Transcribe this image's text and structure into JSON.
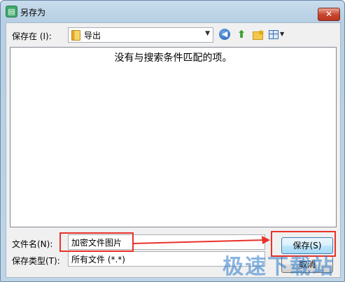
{
  "window": {
    "title": "另存为",
    "close_glyph": "✕"
  },
  "toolbar": {
    "save_in_label": "保存在 (I):",
    "location": "导出",
    "back_icon": "back-arrow-icon",
    "up_icon": "up-folder-icon",
    "new_folder_icon": "new-folder-icon",
    "views_icon": "views-menu-icon"
  },
  "file_list": {
    "empty_message": "没有与搜索条件匹配的项。"
  },
  "form": {
    "filename_label": "文件名(N):",
    "filename_value": "加密文件图片",
    "filetype_label": "保存类型(T):",
    "filetype_value": "所有文件 (*.*)"
  },
  "buttons": {
    "save": "保存(S)",
    "cancel": "取消"
  },
  "overlay": {
    "watermark": "极速下载站",
    "highlight_color": "#e8322a"
  }
}
